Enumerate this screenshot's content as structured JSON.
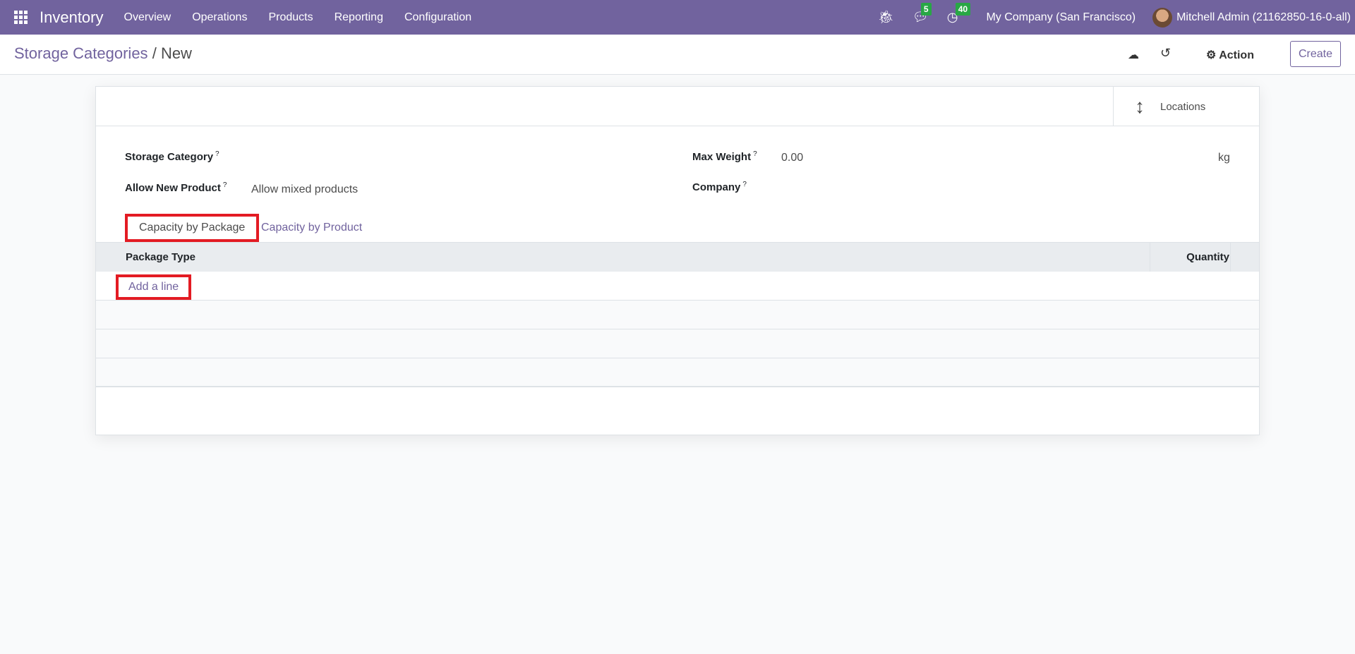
{
  "navbar": {
    "app": "Inventory",
    "menu": [
      "Overview",
      "Operations",
      "Products",
      "Reporting",
      "Configuration"
    ],
    "messages_count": "5",
    "activities_count": "40",
    "company": "My Company (San Francisco)",
    "user": "Mitchell Admin (21162850-16-0-all)"
  },
  "control_panel": {
    "breadcrumb_parent": "Storage Categories",
    "breadcrumb_sep": "/",
    "breadcrumb_current": "New",
    "action_label": "Action",
    "create_label": "Create"
  },
  "form": {
    "locations_button": "Locations",
    "storage_category_label": "Storage Category",
    "allow_new_product_label": "Allow New Product",
    "allow_new_product_value": "Allow mixed products",
    "max_weight_label": "Max Weight",
    "max_weight_value": "0.00",
    "max_weight_unit": "kg",
    "company_label": "Company",
    "help": "?",
    "tabs": [
      "Capacity by Package",
      "Capacity by Product"
    ],
    "table": {
      "columns": [
        "Package Type",
        "Quantity"
      ],
      "add_line": "Add a line"
    }
  }
}
